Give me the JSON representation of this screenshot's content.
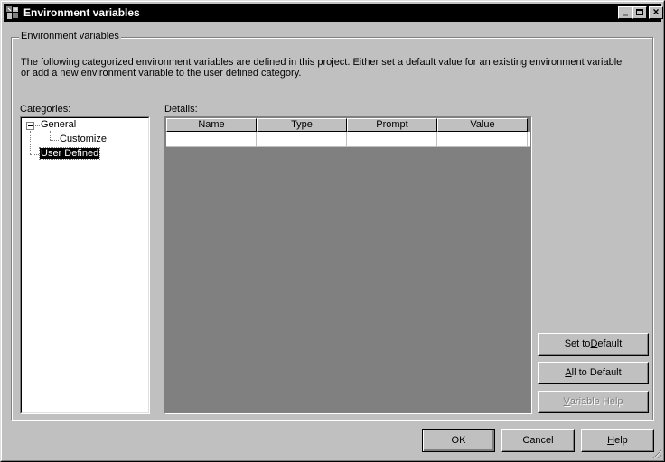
{
  "window": {
    "title": "Environment variables",
    "controls": {
      "minimize": "minimize",
      "maximize": "maximize",
      "close": "×"
    }
  },
  "group": {
    "label": "Environment variables",
    "description": "The following categorized environment variables are defined in this project.  Either set a default value for an existing environment variable or add a new environment variable to the user defined category."
  },
  "categories": {
    "label": "Categories:",
    "tree": [
      {
        "label": "General",
        "expanded": true,
        "children": [
          {
            "label": "Customize"
          }
        ]
      },
      {
        "label": "User Defined",
        "selected": true
      }
    ]
  },
  "details": {
    "label": "Details:",
    "columns": [
      "Name",
      "Type",
      "Prompt",
      "Value"
    ],
    "rows": [
      [
        "",
        "",
        "",
        ""
      ]
    ]
  },
  "side_buttons": {
    "set_to_default": {
      "pre": "Set to ",
      "u": "D",
      "post": "efault",
      "enabled": true
    },
    "all_to_default": {
      "pre": "",
      "u": "A",
      "post": "ll to Default",
      "enabled": true
    },
    "variable_help": {
      "pre": "",
      "u": "V",
      "post": "ariable Help",
      "enabled": false
    }
  },
  "footer": {
    "ok": "OK",
    "cancel": "Cancel",
    "help": {
      "pre": "",
      "u": "H",
      "post": "elp"
    }
  }
}
